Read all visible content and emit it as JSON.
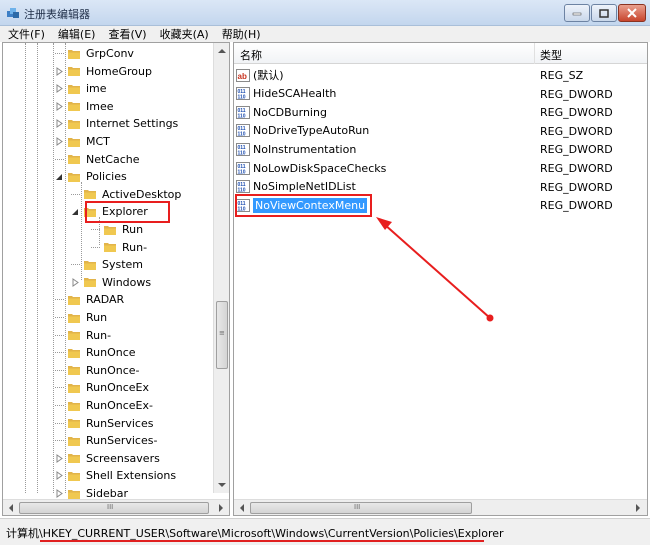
{
  "window": {
    "title": "注册表编辑器"
  },
  "menu": [
    "文件(F)",
    "编辑(E)",
    "查看(V)",
    "收藏夹(A)",
    "帮助(H)"
  ],
  "tree": {
    "items": [
      {
        "label": "GrpConv",
        "level": 1,
        "expander": "none"
      },
      {
        "label": "HomeGroup",
        "level": 1,
        "expander": "collapsed"
      },
      {
        "label": "ime",
        "level": 1,
        "expander": "collapsed"
      },
      {
        "label": "Imee",
        "level": 1,
        "expander": "collapsed"
      },
      {
        "label": "Internet Settings",
        "level": 1,
        "expander": "collapsed"
      },
      {
        "label": "MCT",
        "level": 1,
        "expander": "collapsed"
      },
      {
        "label": "NetCache",
        "level": 1,
        "expander": "none"
      },
      {
        "label": "Policies",
        "level": 1,
        "expander": "expanded"
      },
      {
        "label": "ActiveDesktop",
        "level": 2,
        "expander": "none"
      },
      {
        "label": "Explorer",
        "level": 2,
        "expander": "expanded"
      },
      {
        "label": "Run",
        "level": 3,
        "expander": "none"
      },
      {
        "label": "Run-",
        "level": 3,
        "expander": "none"
      },
      {
        "label": "System",
        "level": 2,
        "expander": "none"
      },
      {
        "label": "Windows",
        "level": 2,
        "expander": "collapsed"
      },
      {
        "label": "RADAR",
        "level": 1,
        "expander": "none"
      },
      {
        "label": "Run",
        "level": 1,
        "expander": "none"
      },
      {
        "label": "Run-",
        "level": 1,
        "expander": "none"
      },
      {
        "label": "RunOnce",
        "level": 1,
        "expander": "none"
      },
      {
        "label": "RunOnce-",
        "level": 1,
        "expander": "none"
      },
      {
        "label": "RunOnceEx",
        "level": 1,
        "expander": "none"
      },
      {
        "label": "RunOnceEx-",
        "level": 1,
        "expander": "none"
      },
      {
        "label": "RunServices",
        "level": 1,
        "expander": "none"
      },
      {
        "label": "RunServices-",
        "level": 1,
        "expander": "none"
      },
      {
        "label": "Screensavers",
        "level": 1,
        "expander": "collapsed"
      },
      {
        "label": "Shell Extensions",
        "level": 1,
        "expander": "collapsed"
      },
      {
        "label": "Sidebar",
        "level": 1,
        "expander": "collapsed"
      }
    ]
  },
  "list": {
    "headers": {
      "name": "名称",
      "type": "类型"
    },
    "rows": [
      {
        "name": "(默认)",
        "type": "REG_SZ",
        "icon": "string-value-icon"
      },
      {
        "name": "HideSCAHealth",
        "type": "REG_DWORD",
        "icon": "dword-value-icon"
      },
      {
        "name": "NoCDBurning",
        "type": "REG_DWORD",
        "icon": "dword-value-icon"
      },
      {
        "name": "NoDriveTypeAutoRun",
        "type": "REG_DWORD",
        "icon": "dword-value-icon"
      },
      {
        "name": "NoInstrumentation",
        "type": "REG_DWORD",
        "icon": "dword-value-icon"
      },
      {
        "name": "NoLowDiskSpaceChecks",
        "type": "REG_DWORD",
        "icon": "dword-value-icon"
      },
      {
        "name": "NoSimpleNetIDList",
        "type": "REG_DWORD",
        "icon": "dword-value-icon"
      },
      {
        "name": "NoViewContexMenu",
        "type": "REG_DWORD",
        "icon": "dword-value-icon",
        "selected": true
      }
    ]
  },
  "status": {
    "path": "计算机\\HKEY_CURRENT_USER\\Software\\Microsoft\\Windows\\CurrentVersion\\Policies\\Explorer"
  },
  "colors": {
    "selection": "#3399ff",
    "annotation": "#e81e1e",
    "folder": "#f0c850"
  }
}
